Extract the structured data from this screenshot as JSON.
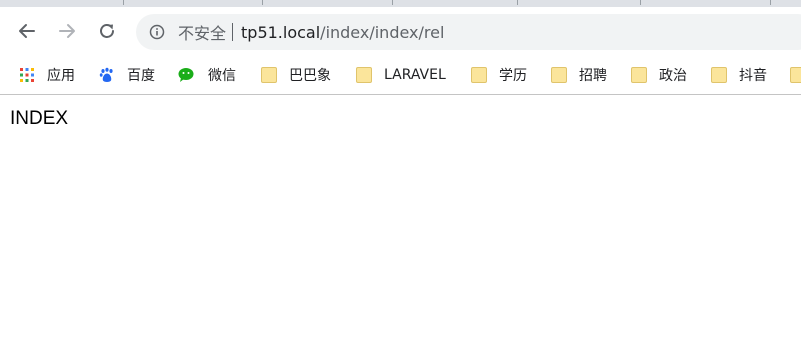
{
  "browser": {
    "security_label": "不安全",
    "url_host": "tp51.local",
    "url_path": "/index/index/rel"
  },
  "bookmarks": [
    {
      "label": "应用",
      "icon": "apps-grid-icon"
    },
    {
      "label": "百度",
      "icon": "baidu-paw-icon"
    },
    {
      "label": "微信",
      "icon": "wechat-icon"
    },
    {
      "label": "巴巴象",
      "icon": "folder-icon"
    },
    {
      "label": "LARAVEL",
      "icon": "folder-icon"
    },
    {
      "label": "学历",
      "icon": "folder-icon"
    },
    {
      "label": "招聘",
      "icon": "folder-icon"
    },
    {
      "label": "政治",
      "icon": "folder-icon"
    },
    {
      "label": "抖音",
      "icon": "folder-icon"
    }
  ],
  "page": {
    "heading": "INDEX"
  },
  "colors": {
    "tabstrip": "#dee1e6",
    "omnibox": "#f1f3f4",
    "folder": "#fbe59b"
  }
}
